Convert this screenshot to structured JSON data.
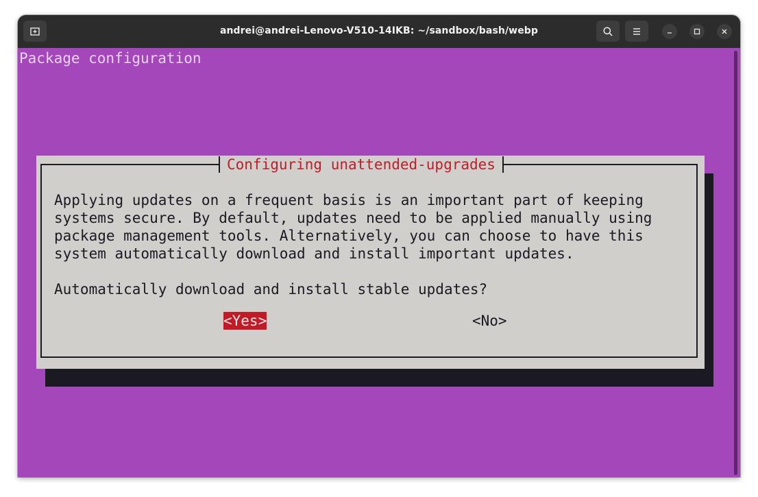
{
  "window": {
    "title": "andrei@andrei-Lenovo-V510-14IKB: ~/sandbox/bash/webp",
    "new_tab_icon": "new-tab-icon",
    "search_icon": "search-icon",
    "menu_icon": "hamburger-menu-icon",
    "minimize_icon": "minimize-icon",
    "maximize_icon": "maximize-icon",
    "close_icon": "close-icon"
  },
  "terminal": {
    "header": "Package configuration",
    "background_color": "#a347ba"
  },
  "dialog": {
    "title": "Configuring unattended-upgrades",
    "lines": [
      "Applying updates on a frequent basis is an important part of keeping",
      "systems secure. By default, updates need to be applied manually using",
      "package management tools. Alternatively, you can choose to have this",
      "system automatically download and install important updates."
    ],
    "question": "Automatically download and install stable updates?",
    "yes_label": "<Yes>",
    "no_label": "<No>",
    "selected": "<Yes>",
    "accent_color": "#c01c28"
  }
}
